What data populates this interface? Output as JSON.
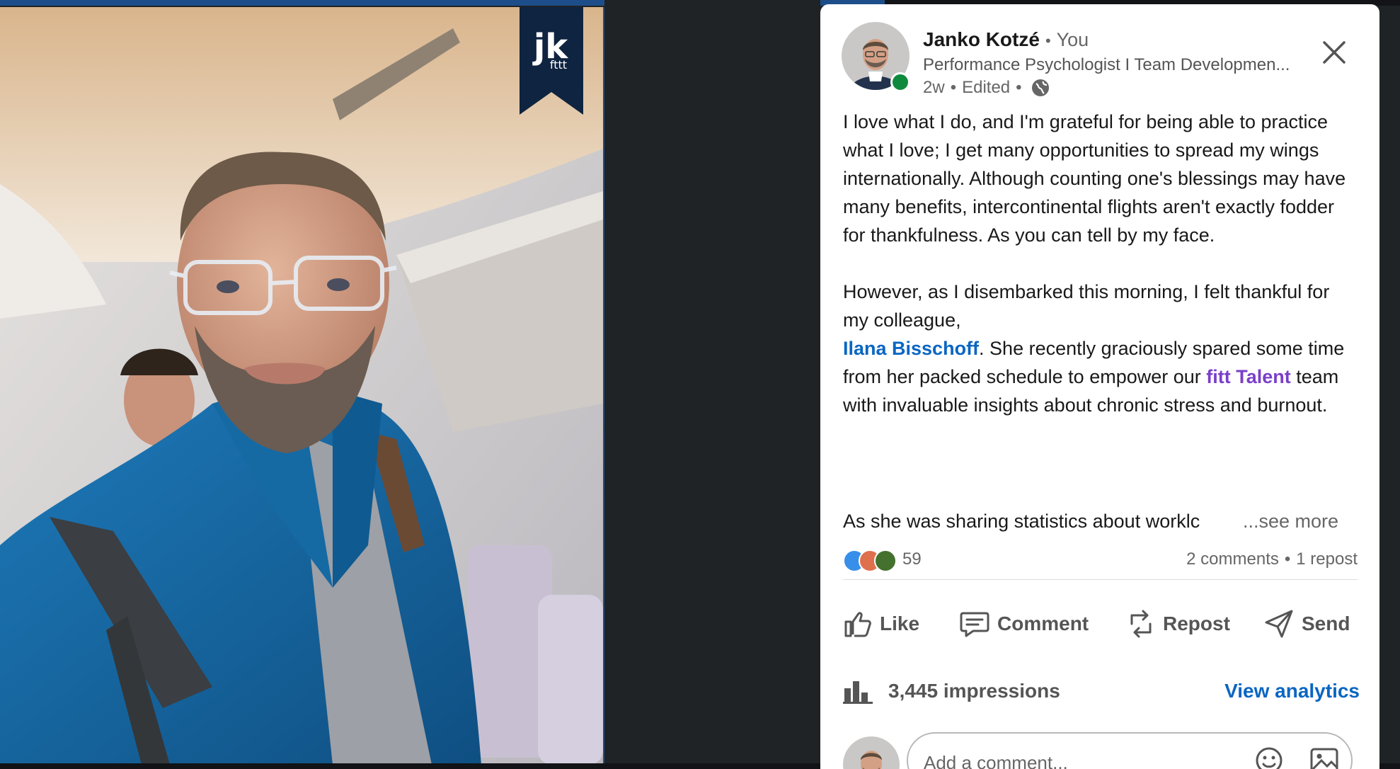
{
  "photo": {
    "badge_text_main": "jk",
    "badge_text_sub": "fttt"
  },
  "post": {
    "author_name": "Janko Kotzé",
    "author_separator": "•",
    "author_relation": "You",
    "headline": "Performance Psychologist I Team Developmen...",
    "time_ago": "2w",
    "edited": "Edited",
    "meta_separator": "•",
    "paragraph1": "I love what I do, and I'm grateful for being able to practice what I love; I get many opportunities to spread my wings internationally. Although counting one's blessings may have many benefits, intercontinental flights aren't exactly fodder for thankfulness. As you can tell by my face.",
    "paragraph2_before": "However, as I disembarked this morning, I felt thankful for my colleague,",
    "mention_name": "Ilana Bisschoff",
    "paragraph2_middle": ". She recently graciously spared some time from her packed schedule to empower our ",
    "company_mention": "fitt Talent",
    "paragraph2_after": " team with invaluable insights about chronic stress and burnout.",
    "truncated_line": "As she was sharing statistics about worklc",
    "see_more": "...see more"
  },
  "social": {
    "reaction_count": "59",
    "comments": "2 comments",
    "separator": "•",
    "reposts": "1 repost"
  },
  "actions": {
    "like": "Like",
    "comment": "Comment",
    "repost": "Repost",
    "send": "Send"
  },
  "analytics": {
    "impressions": "3,445 impressions",
    "view_analytics": "View analytics"
  },
  "comment_box": {
    "placeholder": "Add a comment..."
  },
  "colors": {
    "link_blue": "#0a66c2",
    "company_purple": "#7a3fc9",
    "online_green": "#0f8a3c",
    "badge_navy": "#0f2440",
    "jacket_blue": "#1a6aa6"
  }
}
